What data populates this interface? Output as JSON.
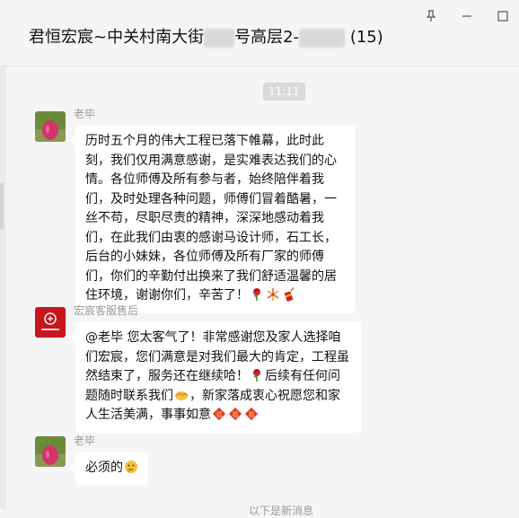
{
  "window": {
    "title_prefix": "君恒宏宸~中关村南大街",
    "title_redact1": "■■",
    "title_middle": "号高层2-",
    "title_redact2": "■■■",
    "title_count": "(15)"
  },
  "chat": {
    "timestamp": "11:11",
    "messages": [
      {
        "sender": "老毕",
        "text": "历时五个月的伟大工程已落下帷幕，此时此刻，我们仅用满意感谢，是实难表达我们的心情。各位师傅及所有参与者，始终陪伴着我们，及时处理各种问题，师傅们冒着酷暑，一丝不苟，尽职尽责的精神，深深地感动着我们，在此我们由衷的感谢马设计师，石工长，后台的小妹妹，各位师傅及所有厂家的师傅们，你们的辛勤付出换来了我们舒适温馨的居住环境，谢谢你们，辛苦了！",
        "emojis": [
          "rose-icon",
          "fireworks-icon",
          "firecracker-icon"
        ]
      },
      {
        "sender": "宏宸客服售后",
        "text_before_rose": "@老毕 您太客气了！非常感谢您及家人选择咱们宏宸，您们满意是对我们最大的肯定，工程虽然结束了，服务还在继续哈！",
        "text_after_rose": "后续有任何问题随时联系我们",
        "text_after_handshake": "，新家落成衷心祝愿您和家人生活美满，事事如意",
        "emojis": [
          "rose-icon",
          "handshake-icon",
          "fu-icon",
          "fu-icon",
          "fu-icon"
        ]
      },
      {
        "sender": "老毕",
        "text": "必须的",
        "emojis": [
          "thinking-face-icon"
        ]
      }
    ],
    "bottom_note": "以下是新消息"
  },
  "colors": {
    "bubble": "#ffffff",
    "background": "#f5f5f5",
    "timestamp_bg": "#dadada",
    "brand_red": "#c8161d"
  }
}
